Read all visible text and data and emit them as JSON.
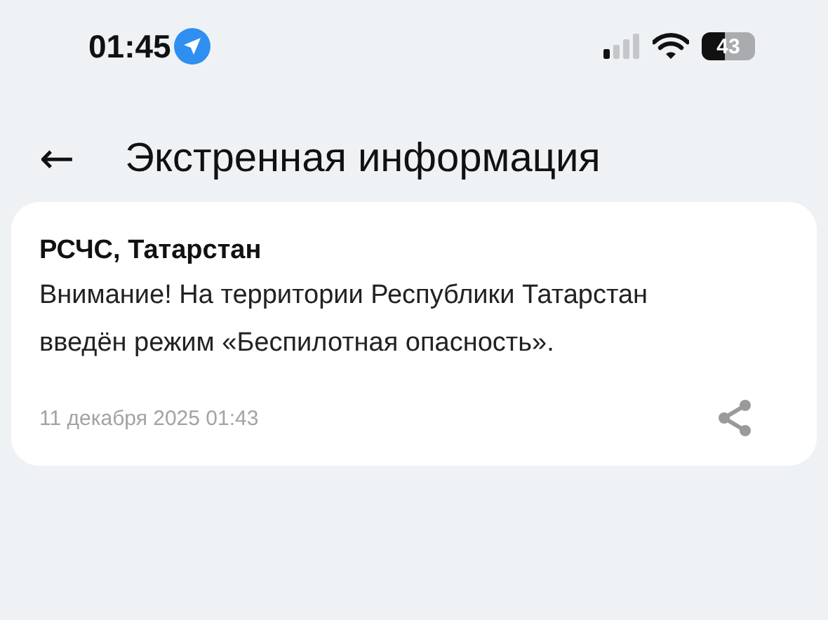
{
  "status_bar": {
    "time": "01:45",
    "battery": "43"
  },
  "header": {
    "back": "←",
    "title": "Экстренная информация"
  },
  "alerts": [
    {
      "source": "РСЧС, Татарстан",
      "message": "Внимание! На территории Республики Татарстан введён режим «Беспилотная опасность».",
      "date": "11 декабря 2025 01:43"
    }
  ]
}
